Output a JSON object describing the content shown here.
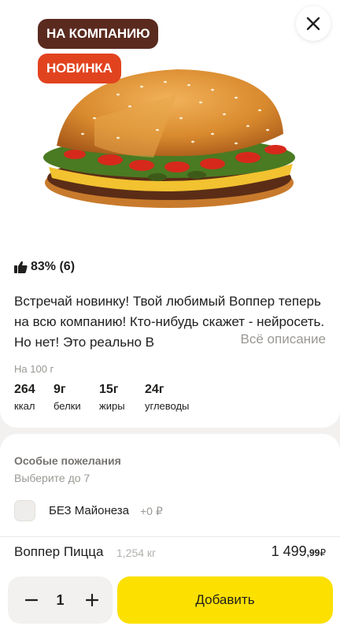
{
  "product": {
    "tags": [
      "НА КОМПАНИЮ",
      "НОВИНКА"
    ],
    "rating": "83% (6)",
    "description": "Встречай новинку! Твой любимый Воппер теперь на всю компанию! Кто-нибудь скажет - нейросеть. Но нет! Это реально В",
    "more_label": "Всё описание",
    "per100_label": "На 100 г",
    "nutrition": [
      {
        "value": "264",
        "label": "ккал"
      },
      {
        "value": "9г",
        "label": "белки"
      },
      {
        "value": "15г",
        "label": "жиры"
      },
      {
        "value": "24г",
        "label": "углеводы"
      }
    ],
    "name": "Воппер Пицца",
    "weight": "1,254 кг",
    "price_main": "1 499",
    "price_cents": ",99",
    "currency": "₽"
  },
  "wishes": {
    "title": "Особые пожелания",
    "subtitle": "Выберите до 7",
    "options": [
      {
        "label": "БЕЗ Майонеза",
        "price": "+0 ₽",
        "checked": false
      }
    ]
  },
  "cart": {
    "quantity": "1",
    "add_label": "Добавить"
  },
  "colors": {
    "add_button": "#fce000",
    "tag_company": "#5a2a1f",
    "tag_new": "#e2431f"
  }
}
